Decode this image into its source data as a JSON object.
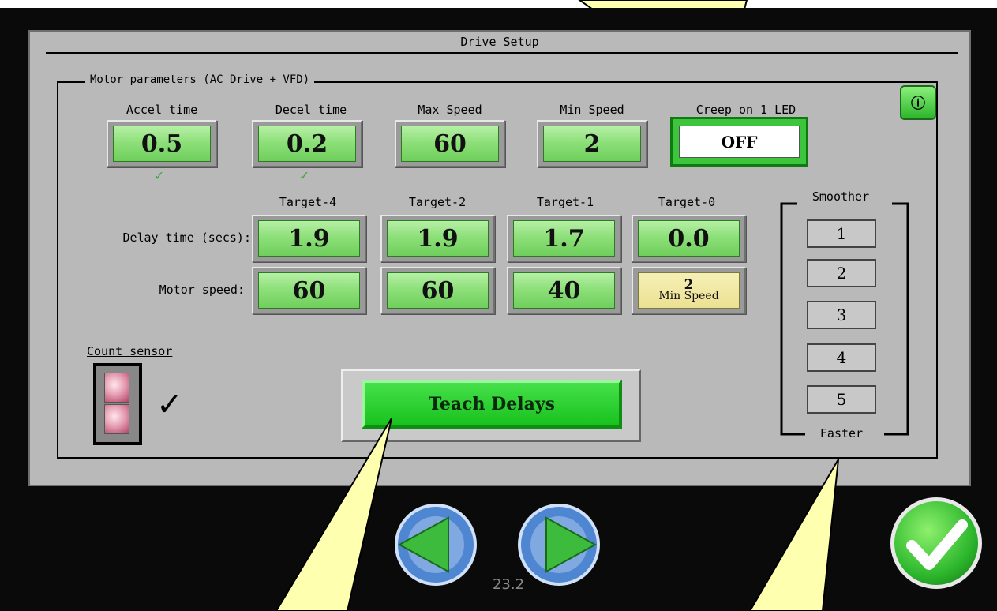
{
  "screen": {
    "title": "Drive Setup",
    "version": "23.2"
  },
  "motor_group": {
    "legend": "Motor parameters (AC Drive + VFD)",
    "params": [
      {
        "label": "Accel time",
        "value": "0.5",
        "checked": true
      },
      {
        "label": "Decel time",
        "value": "0.2",
        "checked": true
      },
      {
        "label": "Max Speed",
        "value": "60",
        "checked": false
      },
      {
        "label": "Min Speed",
        "value": "2",
        "checked": false
      }
    ],
    "creep": {
      "label": "Creep on 1 LED",
      "value": "OFF"
    },
    "tick_mark": "✓"
  },
  "targets": {
    "headers": [
      "Target-4",
      "Target-2",
      "Target-1",
      "Target-0"
    ],
    "delay_label": "Delay time (secs):",
    "delays": [
      "1.9",
      "1.9",
      "1.7",
      "0.0"
    ],
    "speed_label": "Motor speed:",
    "speeds": [
      "60",
      "60",
      "40"
    ],
    "min_speed_cell": {
      "value": "2",
      "caption": "Min Speed"
    }
  },
  "smoother": {
    "title": "Smoother",
    "options": [
      "1",
      "2",
      "3",
      "4",
      "5"
    ],
    "footer": "Faster"
  },
  "count_sensor": {
    "label": "Count sensor",
    "check": "✓"
  },
  "teach_button": {
    "label": "Teach Delays"
  },
  "info_button": {
    "icon": "info-icon",
    "glyph": "ⓘ"
  },
  "colors": {
    "panel_bg": "#b9b9b9",
    "value_green": "#8ee07a",
    "accent_green": "#18c21e",
    "callout_yellow": "#ffffb0",
    "nav_blue": "#5c8fd6"
  }
}
